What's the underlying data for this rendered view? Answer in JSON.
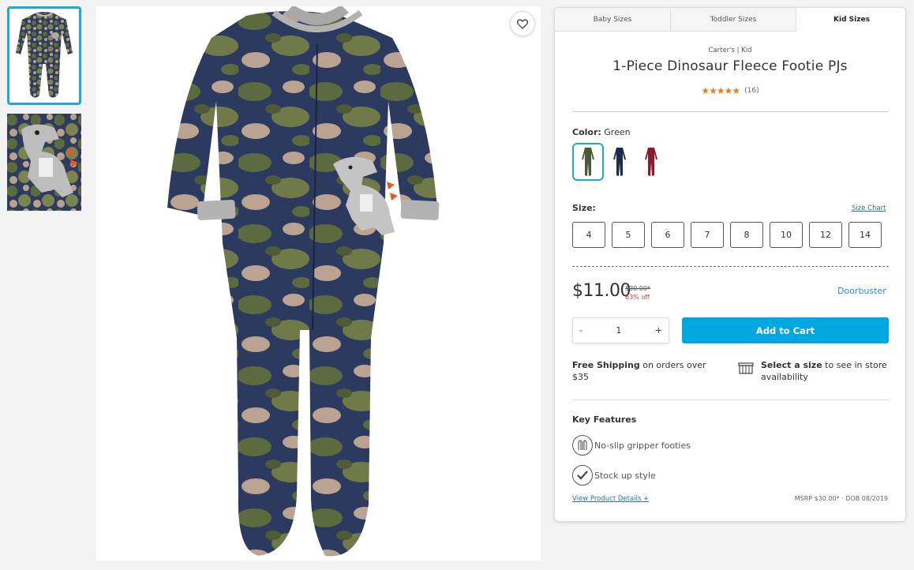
{
  "gallery": {
    "thumbnails": [
      "footie-front",
      "dino-detail"
    ],
    "wishlist_icon": "heart-icon"
  },
  "panel": {
    "tabs": [
      {
        "label": "Baby Sizes",
        "active": false
      },
      {
        "label": "Toddler Sizes",
        "active": false
      },
      {
        "label": "Kid Sizes",
        "active": true
      }
    ],
    "brand": "Carter's | Kid",
    "title": "1-Piece Dinosaur Fleece Footie PJs",
    "rating": {
      "stars": "★★★★★",
      "count": "(16)",
      "value": 5
    },
    "color": {
      "label": "Color:",
      "selected": "Green",
      "swatches": [
        {
          "name": "green-camo",
          "color": "#4a5a38",
          "selected": true
        },
        {
          "name": "navy",
          "color": "#1d2a4a",
          "selected": false
        },
        {
          "name": "burgundy",
          "color": "#8b1a2e",
          "selected": false
        }
      ]
    },
    "size": {
      "label": "Size:",
      "chart_link": "Size Chart",
      "options": [
        "4",
        "5",
        "6",
        "7",
        "8",
        "10",
        "12",
        "14"
      ]
    },
    "price": {
      "current": "$11.00",
      "original": "$30.00*",
      "discount": "63% off",
      "badge": "Doorbuster"
    },
    "quantity": {
      "minus": "-",
      "value": "1",
      "plus": "+"
    },
    "add_to_cart": "Add to Cart",
    "shipping": {
      "bold": "Free Shipping",
      "text": " on orders over $35"
    },
    "store": {
      "bold": "Select a size",
      "text": " to see in store availability"
    },
    "key_features": {
      "title": "Key Features",
      "items": [
        {
          "label": "No-slip gripper footies",
          "icon": "footie-grip-icon"
        },
        {
          "label": "Stock up style",
          "icon": "checkmark-icon"
        }
      ]
    },
    "details_link": "View Product Details",
    "details_link_icon": "+",
    "msrp": "MSRP $30.00* · DOB 08/2019"
  },
  "colors": {
    "accent": "#00a7e1",
    "selected_border": "#1ca9d6",
    "link": "#2b6fc2",
    "star": "#e0811b",
    "discount": "#dd3333"
  }
}
